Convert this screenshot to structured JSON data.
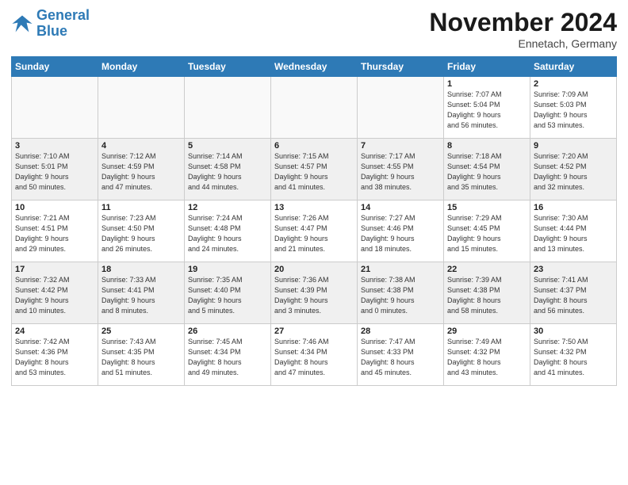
{
  "logo": {
    "line1": "General",
    "line2": "Blue"
  },
  "title": "November 2024",
  "subtitle": "Ennetach, Germany",
  "days_of_week": [
    "Sunday",
    "Monday",
    "Tuesday",
    "Wednesday",
    "Thursday",
    "Friday",
    "Saturday"
  ],
  "weeks": [
    [
      {
        "day": "",
        "info": "",
        "empty": true
      },
      {
        "day": "",
        "info": "",
        "empty": true
      },
      {
        "day": "",
        "info": "",
        "empty": true
      },
      {
        "day": "",
        "info": "",
        "empty": true
      },
      {
        "day": "",
        "info": "",
        "empty": true
      },
      {
        "day": "1",
        "info": "Sunrise: 7:07 AM\nSunset: 5:04 PM\nDaylight: 9 hours\nand 56 minutes."
      },
      {
        "day": "2",
        "info": "Sunrise: 7:09 AM\nSunset: 5:03 PM\nDaylight: 9 hours\nand 53 minutes."
      }
    ],
    [
      {
        "day": "3",
        "info": "Sunrise: 7:10 AM\nSunset: 5:01 PM\nDaylight: 9 hours\nand 50 minutes."
      },
      {
        "day": "4",
        "info": "Sunrise: 7:12 AM\nSunset: 4:59 PM\nDaylight: 9 hours\nand 47 minutes."
      },
      {
        "day": "5",
        "info": "Sunrise: 7:14 AM\nSunset: 4:58 PM\nDaylight: 9 hours\nand 44 minutes."
      },
      {
        "day": "6",
        "info": "Sunrise: 7:15 AM\nSunset: 4:57 PM\nDaylight: 9 hours\nand 41 minutes."
      },
      {
        "day": "7",
        "info": "Sunrise: 7:17 AM\nSunset: 4:55 PM\nDaylight: 9 hours\nand 38 minutes."
      },
      {
        "day": "8",
        "info": "Sunrise: 7:18 AM\nSunset: 4:54 PM\nDaylight: 9 hours\nand 35 minutes."
      },
      {
        "day": "9",
        "info": "Sunrise: 7:20 AM\nSunset: 4:52 PM\nDaylight: 9 hours\nand 32 minutes."
      }
    ],
    [
      {
        "day": "10",
        "info": "Sunrise: 7:21 AM\nSunset: 4:51 PM\nDaylight: 9 hours\nand 29 minutes."
      },
      {
        "day": "11",
        "info": "Sunrise: 7:23 AM\nSunset: 4:50 PM\nDaylight: 9 hours\nand 26 minutes."
      },
      {
        "day": "12",
        "info": "Sunrise: 7:24 AM\nSunset: 4:48 PM\nDaylight: 9 hours\nand 24 minutes."
      },
      {
        "day": "13",
        "info": "Sunrise: 7:26 AM\nSunset: 4:47 PM\nDaylight: 9 hours\nand 21 minutes."
      },
      {
        "day": "14",
        "info": "Sunrise: 7:27 AM\nSunset: 4:46 PM\nDaylight: 9 hours\nand 18 minutes."
      },
      {
        "day": "15",
        "info": "Sunrise: 7:29 AM\nSunset: 4:45 PM\nDaylight: 9 hours\nand 15 minutes."
      },
      {
        "day": "16",
        "info": "Sunrise: 7:30 AM\nSunset: 4:44 PM\nDaylight: 9 hours\nand 13 minutes."
      }
    ],
    [
      {
        "day": "17",
        "info": "Sunrise: 7:32 AM\nSunset: 4:42 PM\nDaylight: 9 hours\nand 10 minutes."
      },
      {
        "day": "18",
        "info": "Sunrise: 7:33 AM\nSunset: 4:41 PM\nDaylight: 9 hours\nand 8 minutes."
      },
      {
        "day": "19",
        "info": "Sunrise: 7:35 AM\nSunset: 4:40 PM\nDaylight: 9 hours\nand 5 minutes."
      },
      {
        "day": "20",
        "info": "Sunrise: 7:36 AM\nSunset: 4:39 PM\nDaylight: 9 hours\nand 3 minutes."
      },
      {
        "day": "21",
        "info": "Sunrise: 7:38 AM\nSunset: 4:38 PM\nDaylight: 9 hours\nand 0 minutes."
      },
      {
        "day": "22",
        "info": "Sunrise: 7:39 AM\nSunset: 4:38 PM\nDaylight: 8 hours\nand 58 minutes."
      },
      {
        "day": "23",
        "info": "Sunrise: 7:41 AM\nSunset: 4:37 PM\nDaylight: 8 hours\nand 56 minutes."
      }
    ],
    [
      {
        "day": "24",
        "info": "Sunrise: 7:42 AM\nSunset: 4:36 PM\nDaylight: 8 hours\nand 53 minutes."
      },
      {
        "day": "25",
        "info": "Sunrise: 7:43 AM\nSunset: 4:35 PM\nDaylight: 8 hours\nand 51 minutes."
      },
      {
        "day": "26",
        "info": "Sunrise: 7:45 AM\nSunset: 4:34 PM\nDaylight: 8 hours\nand 49 minutes."
      },
      {
        "day": "27",
        "info": "Sunrise: 7:46 AM\nSunset: 4:34 PM\nDaylight: 8 hours\nand 47 minutes."
      },
      {
        "day": "28",
        "info": "Sunrise: 7:47 AM\nSunset: 4:33 PM\nDaylight: 8 hours\nand 45 minutes."
      },
      {
        "day": "29",
        "info": "Sunrise: 7:49 AM\nSunset: 4:32 PM\nDaylight: 8 hours\nand 43 minutes."
      },
      {
        "day": "30",
        "info": "Sunrise: 7:50 AM\nSunset: 4:32 PM\nDaylight: 8 hours\nand 41 minutes."
      }
    ]
  ]
}
